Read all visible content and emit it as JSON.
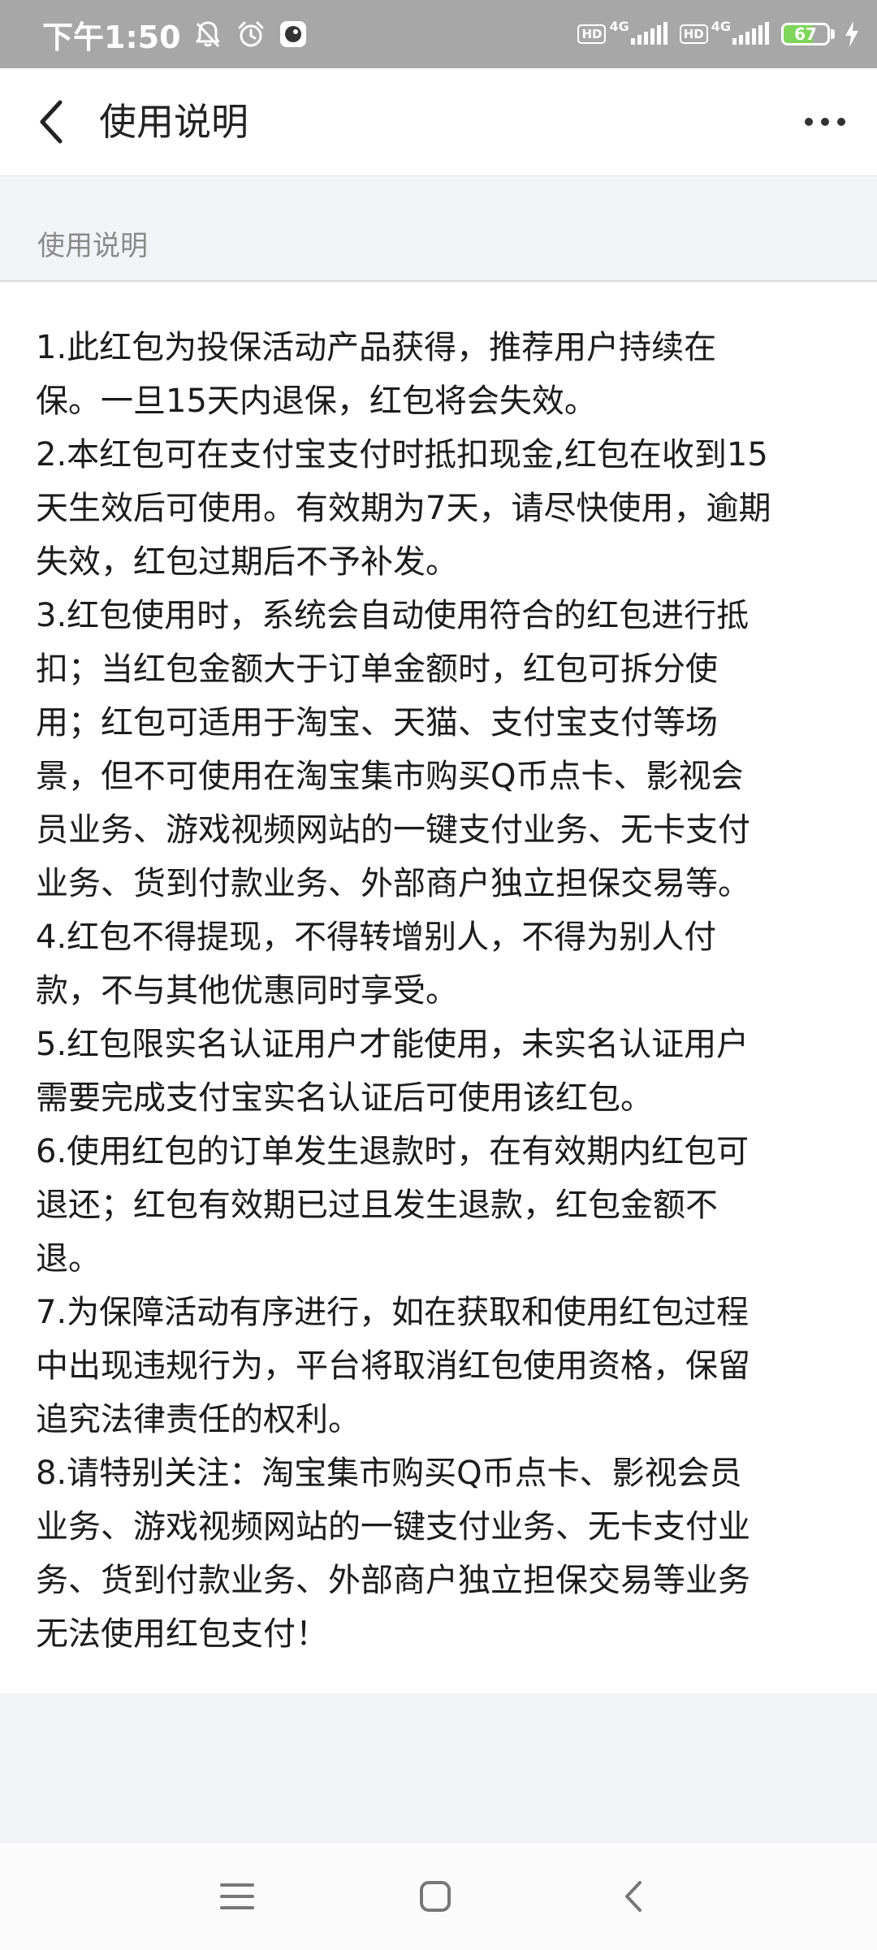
{
  "status_bar": {
    "time": "下午1:50",
    "left_icons": [
      "bell-off-icon",
      "alarm-clock-icon",
      "app-notification-icon"
    ],
    "sim1": {
      "badge": "HD",
      "network": "4G"
    },
    "sim2": {
      "badge": "HD",
      "network": "4G"
    },
    "battery": {
      "level": 67,
      "label": "67",
      "charging": true,
      "fill_color": "#7fd45a"
    }
  },
  "header": {
    "title": "使用说明",
    "back_icon": "chevron-left-icon",
    "more_icon": "more-dots-icon"
  },
  "section": {
    "title": "使用说明"
  },
  "rules": {
    "lines": [
      "1.此红包为投保活动产品获得，推荐用户持续在",
      "保。一旦15天内退保，红包将会失效。",
      "2.本红包可在支付宝支付时抵扣现金,红包在收到15",
      "天生效后可使用。有效期为7天，请尽快使用，逾期",
      "失效，红包过期后不予补发。",
      "3.红包使用时，系统会自动使用符合的红包进行抵",
      "扣；当红包金额大于订单金额时，红包可拆分使",
      "用；红包可适用于淘宝、天猫、支付宝支付等场",
      "景，但不可使用在淘宝集市购买Q币点卡、影视会",
      "员业务、游戏视频网站的一键支付业务、无卡支付",
      "业务、货到付款业务、外部商户独立担保交易等。",
      "4.红包不得提现，不得转增别人，不得为别人付",
      "款，不与其他优惠同时享受。",
      "5.红包限实名认证用户才能使用，未实名认证用户",
      "需要完成支付宝实名认证后可使用该红包。",
      "6.使用红包的订单发生退款时，在有效期内红包可",
      "退还；红包有效期已过且发生退款，红包金额不",
      "退。",
      "7.为保障活动有序进行，如在获取和使用红包过程",
      "中出现违规行为，平台将取消红包使用资格，保留",
      "追究法律责任的权利。",
      "8.请特别关注：淘宝集市购买Q币点卡、影视会员",
      "业务、游戏视频网站的一键支付业务、无卡支付业",
      "务、货到付款业务、外部商户独立担保交易等业务",
      "无法使用红包支付！"
    ]
  },
  "system_nav": {
    "menu_icon": "menu-icon",
    "home_icon": "home-square-icon",
    "back_icon": "back-triangle-icon"
  },
  "colors": {
    "status_bar_bg": "#a7a7a7",
    "page_bg": "#f2f3f7",
    "card_bg": "#ffffff",
    "text": "#1c1c1c",
    "section_title": "#8a8a8a"
  }
}
